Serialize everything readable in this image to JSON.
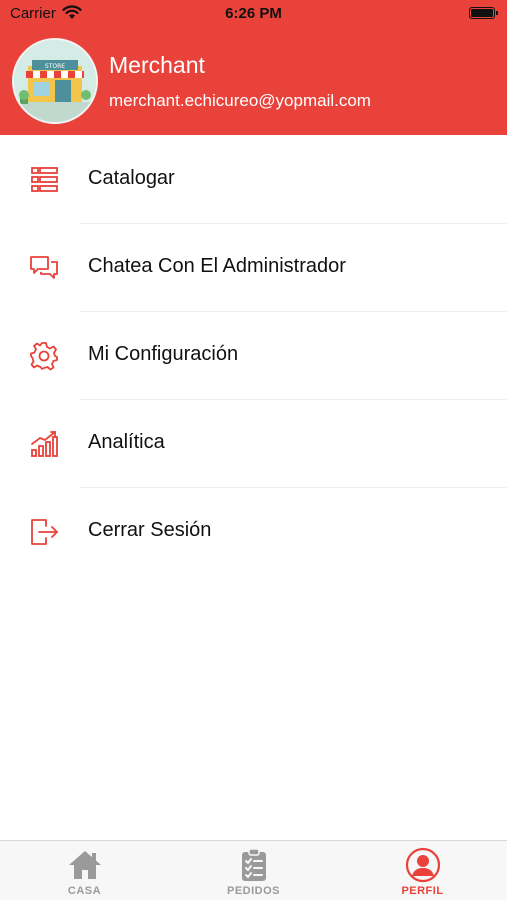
{
  "status_bar": {
    "carrier": "Carrier",
    "time": "6:26 PM"
  },
  "profile": {
    "name": "Merchant",
    "email": "merchant.echicureo@yopmail.com",
    "avatar_sign": "STORE"
  },
  "menu": {
    "items": [
      {
        "label": "Catalogar",
        "icon": "list-icon"
      },
      {
        "label": "Chatea Con El Administrador",
        "icon": "chat-icon"
      },
      {
        "label": "Mi Configuración",
        "icon": "gear-icon"
      },
      {
        "label": "Analítica",
        "icon": "analytics-icon"
      },
      {
        "label": "Cerrar Sesión",
        "icon": "logout-icon"
      }
    ]
  },
  "tabbar": {
    "tabs": [
      {
        "label": "CASA",
        "icon": "home-icon",
        "active": false
      },
      {
        "label": "PEDIDOS",
        "icon": "clipboard-icon",
        "active": false
      },
      {
        "label": "PERFIL",
        "icon": "profile-icon",
        "active": true
      }
    ]
  },
  "colors": {
    "accent": "#e8423a",
    "inactive": "#9a9a9a",
    "header_text": "#ffffff"
  }
}
